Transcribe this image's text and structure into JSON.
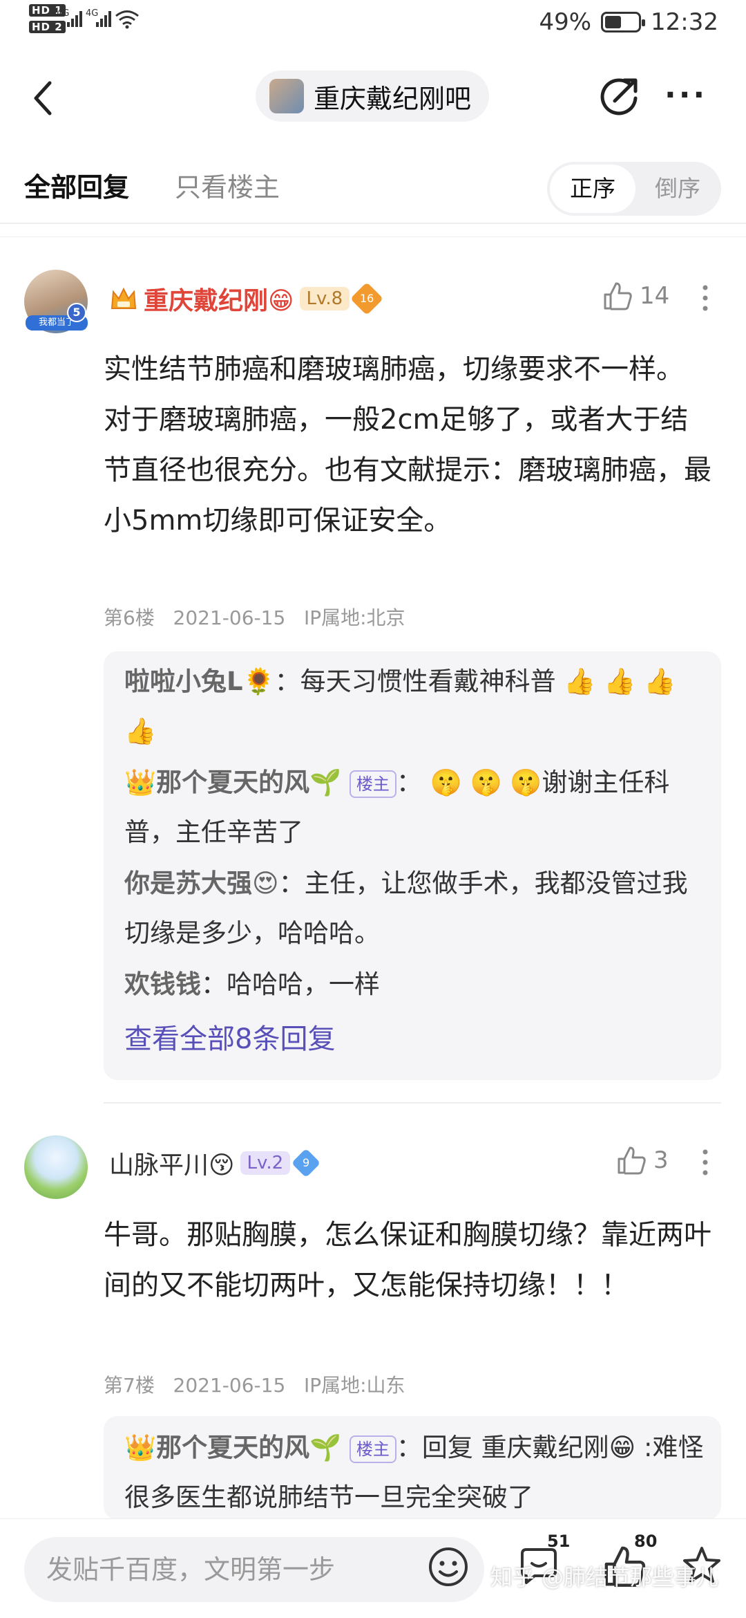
{
  "status": {
    "sim1": "HD 1",
    "sim2": "HD 2",
    "net1": "4G",
    "net2": "4G",
    "battery": "49%",
    "battery_level": 0.49,
    "time": "12:32"
  },
  "header": {
    "forum_name": "重庆戴纪刚吧"
  },
  "tabs": {
    "all": "全部回复",
    "op_only": "只看楼主",
    "sort_asc": "正序",
    "sort_desc": "倒序"
  },
  "posts": [
    {
      "user": "重庆戴纪刚😁",
      "level": "Lv.8",
      "badge": "16",
      "likes": "14",
      "content": "实性结节肺癌和磨玻璃肺癌，切缘要求不一样。\n对于磨玻璃肺癌，一般2cm足够了，或者大于结节直径也很充分。也有文献提示：磨玻璃肺癌，最小5mm切缘即可保证安全。",
      "floor": "第6楼",
      "date": "2021-06-15",
      "ip": "IP属地:北京",
      "avatar_label": "我都当了",
      "avatar_number": "5",
      "replies": [
        {
          "name": "啦啦小兔L🌻",
          "text": "每天习惯性看戴神科普 👍 👍 👍 👍"
        },
        {
          "name": "那个夏天的风🌱",
          "tag": "楼主",
          "text": " 🤫 🤫 🤫谢谢主任科普，主任辛苦了"
        },
        {
          "name": "你是苏大强😍",
          "text": "主任，让您做手术，我都没管过我切缘是多少，哈哈哈。"
        },
        {
          "name": "欢钱钱",
          "text": "哈哈哈，一样"
        }
      ],
      "see_all": "查看全部8条回复"
    },
    {
      "user": "山脉平川😚",
      "level": "Lv.2",
      "badge": "9",
      "likes": "3",
      "content": "牛哥。那贴胸膜，怎么保证和胸膜切缘？靠近两叶间的又不能切两叶，又怎能保持切缘！！！",
      "floor": "第7楼",
      "date": "2021-06-15",
      "ip": "IP属地:山东",
      "replies": [
        {
          "name": "那个夏天的风🌱",
          "tag": "楼主",
          "text": "回复 重庆戴纪刚😁 :难怪很多医生都说肺结节一旦完全突破了"
        }
      ]
    }
  ],
  "bottom": {
    "placeholder": "发贴千百度，文明第一步",
    "comment_count": "51",
    "like_count": "80"
  },
  "watermark": "知乎 @肺结节那些事儿",
  "colors": {
    "accent": "#5850b8",
    "vip_name": "#e0453a",
    "level8_bg": "#fbe9c9",
    "level2_bg": "#e8e1fa"
  }
}
